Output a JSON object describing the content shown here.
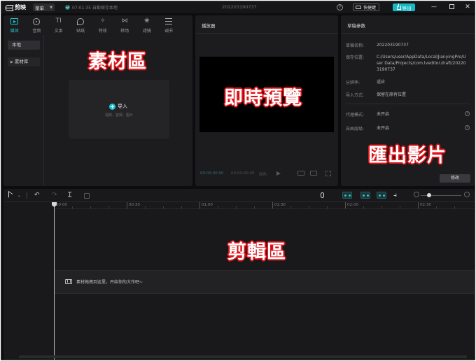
{
  "app": {
    "logo_text": "剪映",
    "menu_label": "菜单",
    "autosave_text": "07:01:35 自動保存本地",
    "project_name": "202203190737",
    "shortcut_label": "快捷鍵",
    "export_label": "导出"
  },
  "media_panel": {
    "tabs": [
      {
        "label": "媒体",
        "icon": "media-icon",
        "active": true
      },
      {
        "label": "音频",
        "icon": "audio-icon",
        "active": false
      },
      {
        "label": "文本",
        "icon": "text-icon",
        "active": false
      },
      {
        "label": "贴纸",
        "icon": "sticker-icon",
        "active": false
      },
      {
        "label": "特效",
        "icon": "effects-icon",
        "active": false
      },
      {
        "label": "转场",
        "icon": "transition-icon",
        "active": false
      },
      {
        "label": "滤镜",
        "icon": "filter-icon",
        "active": false
      },
      {
        "label": "调节",
        "icon": "adjust-icon",
        "active": false
      }
    ],
    "tab_glyphs": {
      "text": "TI",
      "transition": "⋈",
      "filter": "❀",
      "effects": "✧"
    },
    "side": {
      "local": "本地",
      "library": "素材库"
    },
    "import_label": "导入",
    "import_hint": "视频、音频、图片"
  },
  "player": {
    "title": "播放器",
    "time_current": "00:00:00:00",
    "time_total": "00:00:00:00",
    "mode": "原色"
  },
  "params": {
    "title": "草稿参数",
    "rows": [
      {
        "key": "草稿名称:",
        "value": "202203190737"
      },
      {
        "key": "保存位置:",
        "value": "C:/Users/user/AppData/Local/JianyingPro/User Data/Projects/com.lveditor.draft/202203190737"
      },
      {
        "key": "分辨率:",
        "value": "适应"
      },
      {
        "key": "导入方式:",
        "value": "保留在原有位置"
      },
      {
        "key": "代理模式:",
        "value": "未开启"
      },
      {
        "key": "自由层级:",
        "value": "未开启"
      }
    ],
    "modify_label": "修改"
  },
  "timeline": {
    "ticks": [
      "00:00",
      "00:30",
      "01:00",
      "01:30",
      "02:00",
      "02:30"
    ],
    "hint": "素材拖拽到这里，开始你的大作吧~"
  },
  "annotations": {
    "media": "素材區",
    "player": "即時預覽",
    "export": "匯出影片",
    "edit": "剪輯區"
  }
}
